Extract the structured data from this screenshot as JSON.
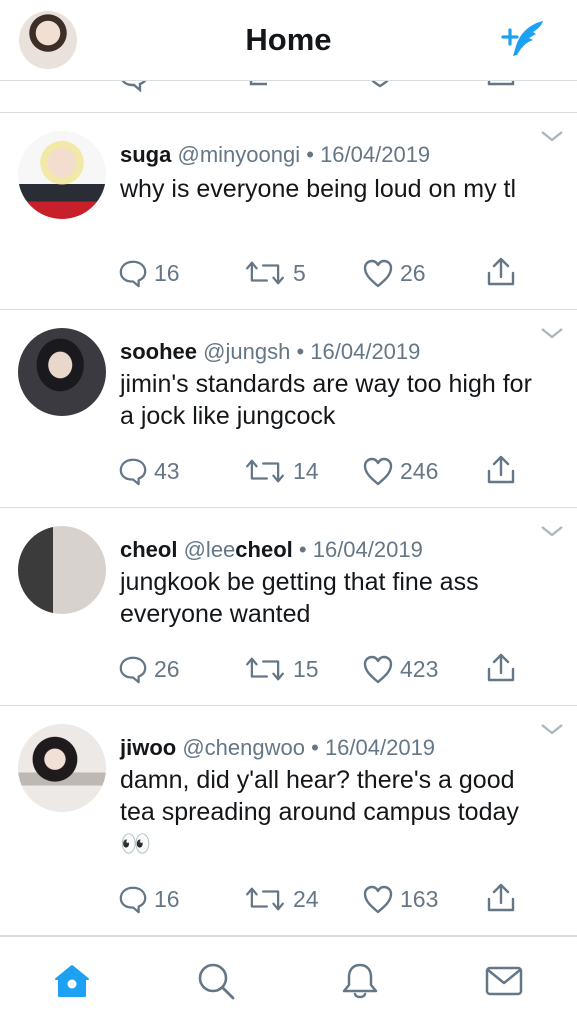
{
  "header": {
    "title": "Home",
    "avatar_icon": "profile-avatar",
    "compose_icon": "compose-tweet-feather-icon"
  },
  "colors": {
    "accent": "#1da1f2",
    "text_primary": "#14171a",
    "text_secondary": "#657786",
    "divider": "#d8dde2"
  },
  "tweets": [
    {
      "name": "suga",
      "handle": "@minyoongi",
      "separator": "•",
      "date": "16/04/2019",
      "text": "why is everyone being loud on my tl",
      "replies": "16",
      "retweets": "5",
      "likes": "26"
    },
    {
      "name": "soohee",
      "handle": "@jungsh",
      "separator": "•",
      "date": "16/04/2019",
      "text": "jimin's standards are way too high for a jock like jungcock",
      "replies": "43",
      "retweets": "14",
      "likes": "246"
    },
    {
      "name": "cheol",
      "handle_prefix": "@lee",
      "handle_bold": "cheol",
      "separator": "•",
      "date": "16/04/2019",
      "text": "jungkook be getting that fine ass everyone wanted",
      "replies": "26",
      "retweets": "15",
      "likes": "423"
    },
    {
      "name": "jiwoo",
      "handle": "@chengwoo",
      "separator": "•",
      "date": "16/04/2019",
      "text": "damn, did y'all hear? there's a good tea spreading around campus today 👀",
      "replies": "16",
      "retweets": "24",
      "likes": "163"
    }
  ],
  "tabbar": {
    "items": [
      "home-icon",
      "search-icon",
      "notifications-bell-icon",
      "messages-envelope-icon"
    ],
    "active": "home-icon"
  }
}
